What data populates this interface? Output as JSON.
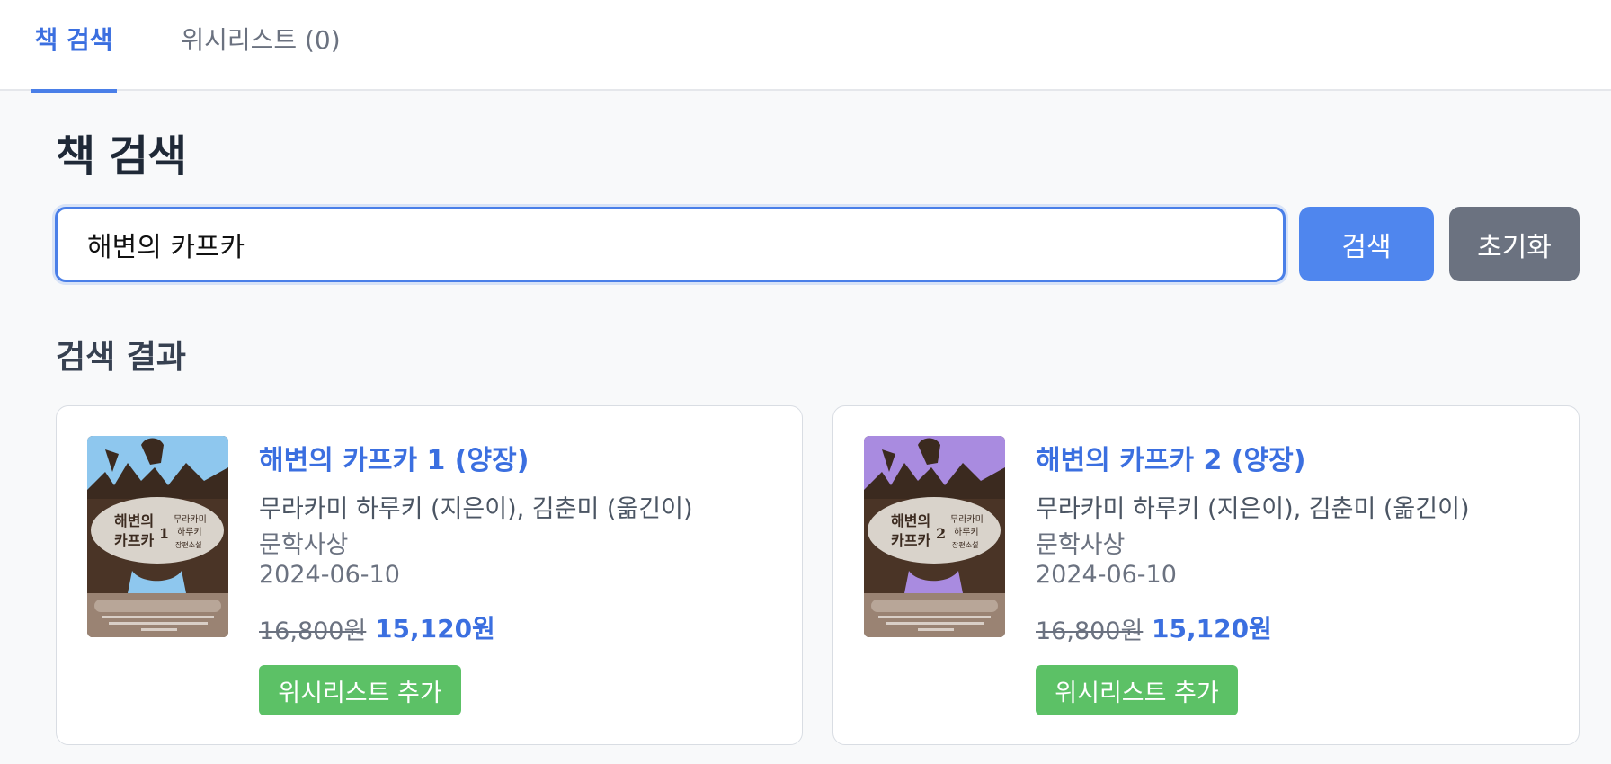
{
  "tabs": [
    {
      "label": "책 검색",
      "active": true
    },
    {
      "label": "위시리스트 (0)",
      "active": false
    }
  ],
  "page_title": "책 검색",
  "search": {
    "value": "해변의 카프카",
    "button_label": "검색",
    "reset_label": "초기화"
  },
  "results_title": "검색 결과",
  "results": [
    {
      "title": "해변의 카프카 1 (양장)",
      "authors": "무라카미 하루키 (지은이), 김춘미 (옮긴이)",
      "publisher": "문학사상",
      "date": "2024-06-10",
      "price_original": "16,800원",
      "price_sale": "15,120원",
      "wish_label": "위시리스트 추가",
      "cover": {
        "title_line1": "해변의",
        "title_line2": "카프카",
        "volume": "1",
        "author_line1": "무라카미",
        "author_line2": "하루키",
        "subtitle": "장편소설",
        "sky_color": "#8ec7ee"
      }
    },
    {
      "title": "해변의 카프카 2 (양장)",
      "authors": "무라카미 하루키 (지은이), 김춘미 (옮긴이)",
      "publisher": "문학사상",
      "date": "2024-06-10",
      "price_original": "16,800원",
      "price_sale": "15,120원",
      "wish_label": "위시리스트 추가",
      "cover": {
        "title_line1": "해변의",
        "title_line2": "카프카",
        "volume": "2",
        "author_line1": "무라카미",
        "author_line2": "하루키",
        "subtitle": "장편소설",
        "sky_color": "#a98be0"
      }
    }
  ]
}
